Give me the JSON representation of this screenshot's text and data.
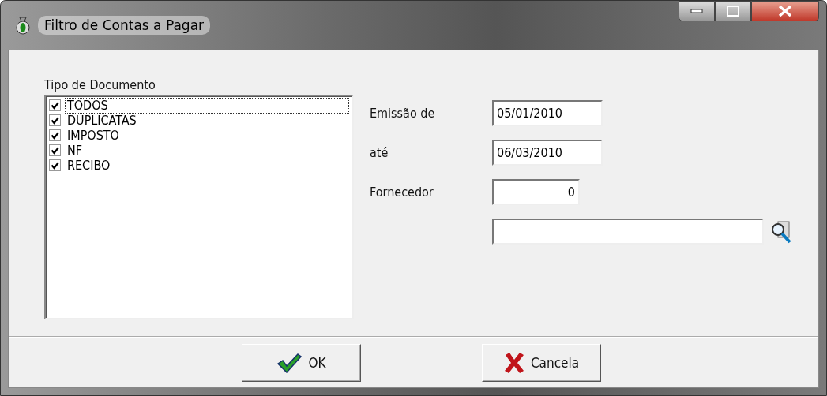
{
  "window": {
    "title": "Filtro de Contas a Pagar"
  },
  "document_types": {
    "label": "Tipo de Documento",
    "items": [
      {
        "label": "TODOS",
        "checked": true,
        "focused": true
      },
      {
        "label": "DUPLICATAS",
        "checked": true,
        "focused": false
      },
      {
        "label": "IMPOSTO",
        "checked": true,
        "focused": false
      },
      {
        "label": "NF",
        "checked": true,
        "focused": false
      },
      {
        "label": "RECIBO",
        "checked": true,
        "focused": false
      }
    ]
  },
  "fields": [
    {
      "label": "Emissão de",
      "value": "05/01/2010",
      "kind": "date"
    },
    {
      "label": "até",
      "value": "06/03/2010",
      "kind": "date"
    },
    {
      "label": "Fornecedor",
      "value": "0",
      "kind": "code"
    },
    {
      "kind": "search"
    }
  ],
  "buttons": [
    {
      "label": "OK",
      "kind": "ok"
    },
    {
      "label": "Cancela",
      "kind": "cancel"
    }
  ]
}
